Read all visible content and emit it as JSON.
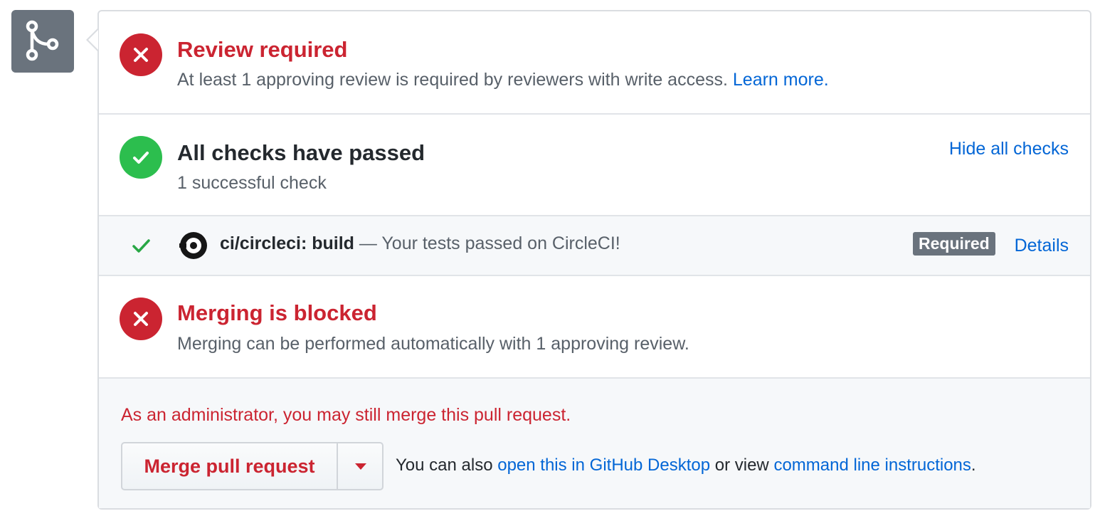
{
  "icons": {
    "merge": "git-merge-icon",
    "fail": "x-icon",
    "pass": "check-icon",
    "circleci": "circleci-logo-icon"
  },
  "colors": {
    "danger": "#cb2431",
    "success": "#2cbe4e",
    "link": "#0366d6",
    "muted": "#586069",
    "badge_bg": "#6a737d"
  },
  "review": {
    "title": "Review required",
    "description": "At least 1 approving review is required by reviewers with write access.",
    "link_label": "Learn more."
  },
  "checks": {
    "title": "All checks have passed",
    "summary": "1 successful check",
    "toggle_label": "Hide all checks",
    "items": [
      {
        "name": "ci/circleci: build",
        "separator": "—",
        "description": "Your tests passed on CircleCI!",
        "badge": "Required",
        "details_label": "Details"
      }
    ]
  },
  "merge_status": {
    "title": "Merging is blocked",
    "description": "Merging can be performed automatically with 1 approving review."
  },
  "admin": {
    "message": "As an administrator, you may still merge this pull request.",
    "merge_button_label": "Merge pull request",
    "alt_prefix": "You can also",
    "desktop_link": "open this in GitHub Desktop",
    "alt_middle": "or view",
    "cli_link": "command line instructions",
    "alt_suffix": "."
  }
}
